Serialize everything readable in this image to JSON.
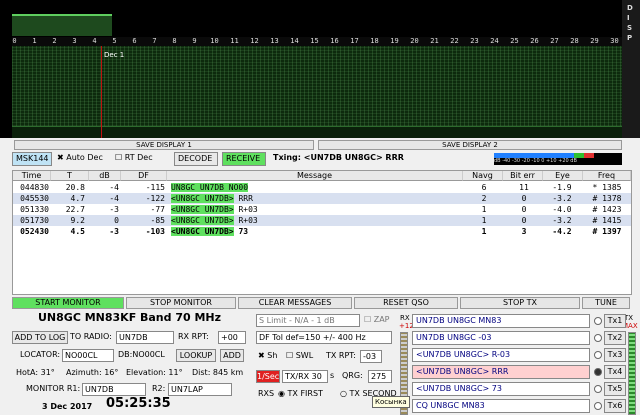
{
  "waterfall": {
    "side_label": "DISP",
    "ticks": [
      "0",
      "1",
      "2",
      "3",
      "4",
      "5",
      "6",
      "7",
      "8",
      "9",
      "10",
      "11",
      "12",
      "13",
      "14",
      "15",
      "16",
      "17",
      "18",
      "19",
      "20",
      "21",
      "22",
      "23",
      "24",
      "25",
      "26",
      "27",
      "28",
      "29",
      "30"
    ],
    "marker_label": "Dec 1"
  },
  "save_display_1": "SAVE DISPLAY 1",
  "save_display_2": "SAVE DISPLAY 2",
  "mode": {
    "label": "MSK144",
    "auto_dec": "Auto Dec",
    "rt_dec": "RT Dec",
    "decode": "DECODE",
    "receive": "RECEIVE",
    "txing": "Txing: <UN7DB UN8GC> RRR",
    "meter_scale": "dB -40 -30 -20 -10 0 +10 +20 dB"
  },
  "table": {
    "headers": [
      "Time",
      "T",
      "dB",
      "DF",
      "Message",
      "Navg",
      "Bit err",
      "Eye",
      "Freq"
    ],
    "rows": [
      {
        "time": "044830",
        "t": "20.8",
        "db": "-4",
        "df": "-115",
        "msg_hl": "UN8GC UN7DB NO00",
        "msg_rest": "",
        "navg": "6",
        "biterr": "11",
        "eye": "-1.9",
        "freq": "* 1385",
        "style": ""
      },
      {
        "time": "045530",
        "t": "4.7",
        "db": "-4",
        "df": "-122",
        "msg_hl": "<UN8GC UN7DB>",
        "msg_rest": " RRR",
        "navg": "2",
        "biterr": "0",
        "eye": "-3.2",
        "freq": "# 1378",
        "style": "alt"
      },
      {
        "time": "051330",
        "t": "22.7",
        "db": "-3",
        "df": "-77",
        "msg_hl": "<UN8GC UN7DB>",
        "msg_rest": " R+03",
        "navg": "1",
        "biterr": "0",
        "eye": "-4.0",
        "freq": "# 1423",
        "style": ""
      },
      {
        "time": "051730",
        "t": "9.2",
        "db": "0",
        "df": "-85",
        "msg_hl": "<UN8GC UN7DB>",
        "msg_rest": " R+03",
        "navg": "1",
        "biterr": "0",
        "eye": "-3.2",
        "freq": "# 1415",
        "style": "alt"
      },
      {
        "time": "052430",
        "t": "4.5",
        "db": "-3",
        "df": "-103",
        "msg_hl": "<UN8GC UN7DB>",
        "msg_rest": " 73",
        "navg": "1",
        "biterr": "3",
        "eye": "-4.2",
        "freq": "# 1397",
        "style": "bold"
      }
    ]
  },
  "controls": {
    "start": "START MONITOR",
    "stop": "STOP MONITOR",
    "clear": "CLEAR MESSAGES",
    "reset": "RESET QSO",
    "stoptx": "STOP TX",
    "tune": "TUNE"
  },
  "station": {
    "title": "UN8GC MN83KF",
    "band": "Band 70 MHz",
    "add_log": "ADD TO LOG",
    "to_radio": "TO RADIO:",
    "to_radio_val": "UN7DB",
    "rx_rpt": "RX RPT:",
    "rx_rpt_val": "+00",
    "locator": "LOCATOR:",
    "locator_val": "NO00CL",
    "db_label": "DB:NO00CL",
    "lookup": "LOOKUP",
    "add": "ADD",
    "hota": "HotA: 31°",
    "azimuth": "Azimuth: 16°",
    "elevation": "Elevation: 11°",
    "dist": "Dist: 845 km",
    "monitor_r1": "MONITOR R1:",
    "r1_val": "UN7DB",
    "r2": "R2:",
    "r2_val": "UN7LAP",
    "date": "3 Dec 2017",
    "time": "05:25:35"
  },
  "mid": {
    "s_limit": "S Limit - N/A - 1  dB",
    "zap": "ZAP",
    "df_tol": "DF Tol def=150 +/-  400  Hz",
    "sh": "Sh",
    "swl": "SWL",
    "tx_rpt": "TX RPT:",
    "tx_rpt_val": "-03",
    "sec_btn": "1/Sec",
    "txrx": "TX/RX 30",
    "txrx_unit": "s",
    "qrg": "QRG:",
    "qrg_val": "275",
    "rxs": "RXS",
    "tx_first": "TX FIRST",
    "tx_second": "TX SECOND"
  },
  "right": {
    "rx": "RX",
    "plus12": "+12",
    "tx": "TX",
    "max": "MAX",
    "msgs": [
      {
        "text": "UN7DB UN8GC MN83",
        "btn": "Tx1"
      },
      {
        "text": "UN7DB UN8GC -03",
        "btn": "Tx2"
      },
      {
        "text": "<UN7DB UN8GC> R-03",
        "btn": "Tx3"
      },
      {
        "text": "<UN7DB UN8GC> RRR",
        "btn": "Tx4"
      },
      {
        "text": "<UN7DB UN8GC> 73",
        "btn": "Tx5"
      },
      {
        "text": "CQ UN8GC MN83",
        "btn": "Tx6"
      }
    ],
    "tooltip": "Косынка"
  },
  "colors": {
    "accent_green": "#5fe05f",
    "selected_msg": "#ffd0d0",
    "sec_btn": "#e02020"
  }
}
